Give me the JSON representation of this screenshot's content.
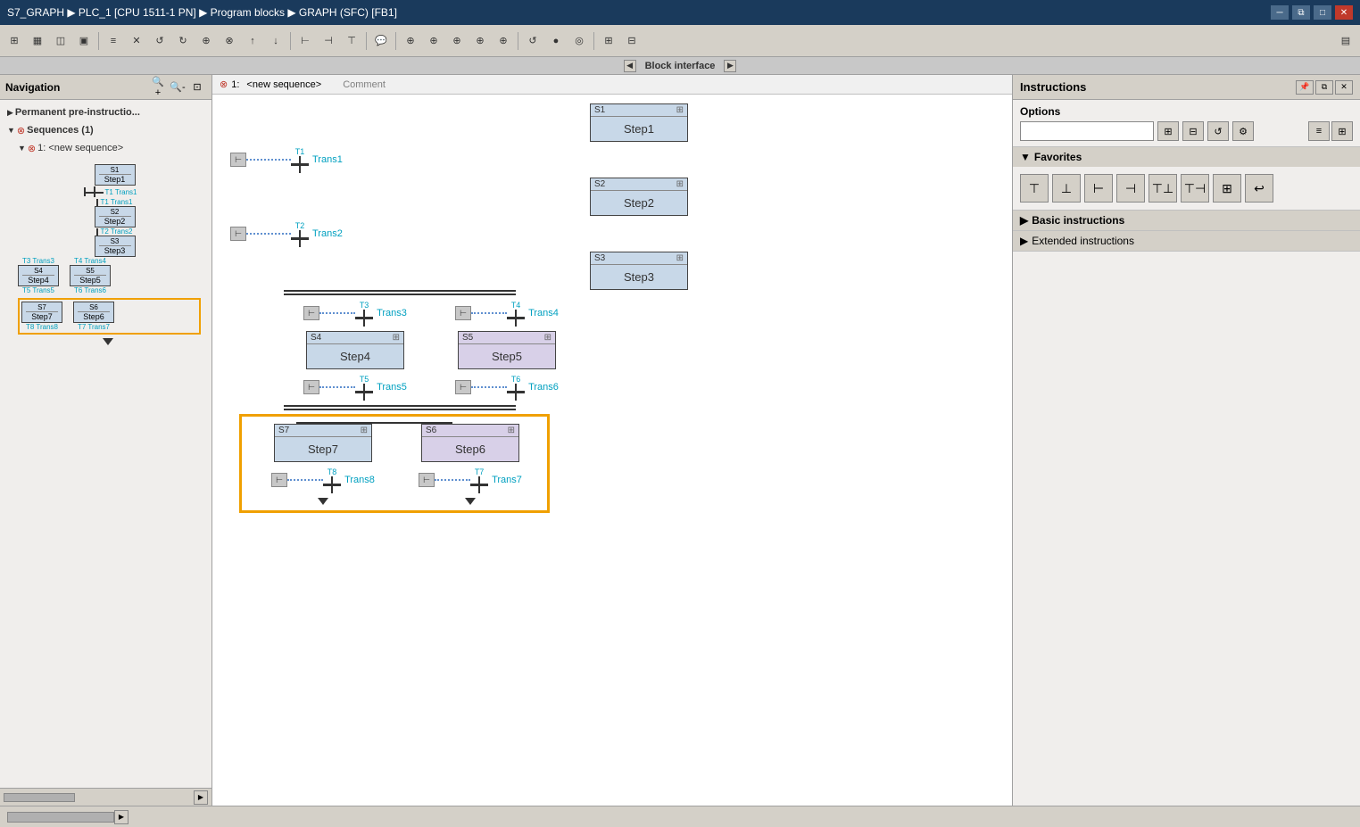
{
  "titlebar": {
    "title": "S7_GRAPH ▶ PLC_1 [CPU 1511-1 PN] ▶ Program blocks ▶ GRAPH (SFC) [FB1]"
  },
  "toolbar": {
    "buttons": [
      "⊞",
      "▦",
      "◫",
      "▣",
      "≡⊡",
      "⊟",
      "⊠",
      "↺",
      "↻",
      "⊕",
      "⊗",
      "⊕",
      "⊗",
      "⊢",
      "⊤",
      "⊥",
      "💬",
      "⊕",
      "⊕",
      "⊕",
      "⊕",
      "⊕",
      "↺",
      "●●",
      "◎",
      "⊞",
      "⊟"
    ]
  },
  "block_interface": {
    "label": "Block interface"
  },
  "navigation": {
    "title": "Navigation",
    "items": [
      {
        "id": "permanent",
        "label": "Permanent pre-instructio...",
        "indent": 1,
        "expandable": true
      },
      {
        "id": "sequences",
        "label": "Sequences (1)",
        "indent": 1,
        "expandable": true,
        "has_error": true
      },
      {
        "id": "seq1",
        "label": "1: <new sequence>",
        "indent": 2,
        "expandable": true,
        "has_error": true
      }
    ]
  },
  "canvas": {
    "header": {
      "error_label": "1:",
      "sequence_name": "<new sequence>",
      "comment": "Comment"
    },
    "steps": [
      {
        "id": "S1",
        "name": "Step1"
      },
      {
        "id": "S2",
        "name": "Step2"
      },
      {
        "id": "S3",
        "name": "Step3"
      },
      {
        "id": "S4",
        "name": "Step4"
      },
      {
        "id": "S5",
        "name": "Step5"
      },
      {
        "id": "S6",
        "name": "Step6"
      },
      {
        "id": "S7",
        "name": "Step7"
      }
    ],
    "transitions": [
      {
        "id": "T1",
        "name": "Trans1"
      },
      {
        "id": "T2",
        "name": "Trans2"
      },
      {
        "id": "T3",
        "name": "Trans3"
      },
      {
        "id": "T4",
        "name": "Trans4"
      },
      {
        "id": "T5",
        "name": "Trans5"
      },
      {
        "id": "T6",
        "name": "Trans6"
      },
      {
        "id": "T7",
        "name": "Trans7"
      },
      {
        "id": "T8",
        "name": "Trans8"
      }
    ]
  },
  "instructions_panel": {
    "title": "Instructions",
    "options": {
      "label": "Options",
      "search_placeholder": ""
    },
    "favorites": {
      "label": "Favorites",
      "icons": [
        "⊤",
        "⊥",
        "⊢",
        "⊣",
        "⊤⊥",
        "⊤⊣",
        "⊞",
        "↩"
      ]
    },
    "basic_instructions": {
      "label": "Basic instructions"
    }
  },
  "nav_diagram": {
    "steps": [
      {
        "id": "S1",
        "name": "Step1"
      },
      {
        "id": "S2",
        "name": "Step2"
      },
      {
        "id": "S3",
        "name": "Step3"
      },
      {
        "id": "S4",
        "name": "Step4"
      },
      {
        "id": "S5",
        "name": "Step5"
      },
      {
        "id": "S6",
        "name": "Step6"
      },
      {
        "id": "S7",
        "name": "Step7"
      }
    ],
    "transitions": [
      {
        "id": "T1",
        "name": "Trans1"
      },
      {
        "id": "T2",
        "name": "Trans2"
      },
      {
        "id": "T3",
        "name": "Trans3"
      },
      {
        "id": "T4",
        "name": "Trans4"
      },
      {
        "id": "T5",
        "name": "Trans5"
      },
      {
        "id": "T6",
        "name": "Trans6"
      },
      {
        "id": "T7",
        "name": "Trans7"
      },
      {
        "id": "T8",
        "name": "Trans8"
      }
    ]
  }
}
